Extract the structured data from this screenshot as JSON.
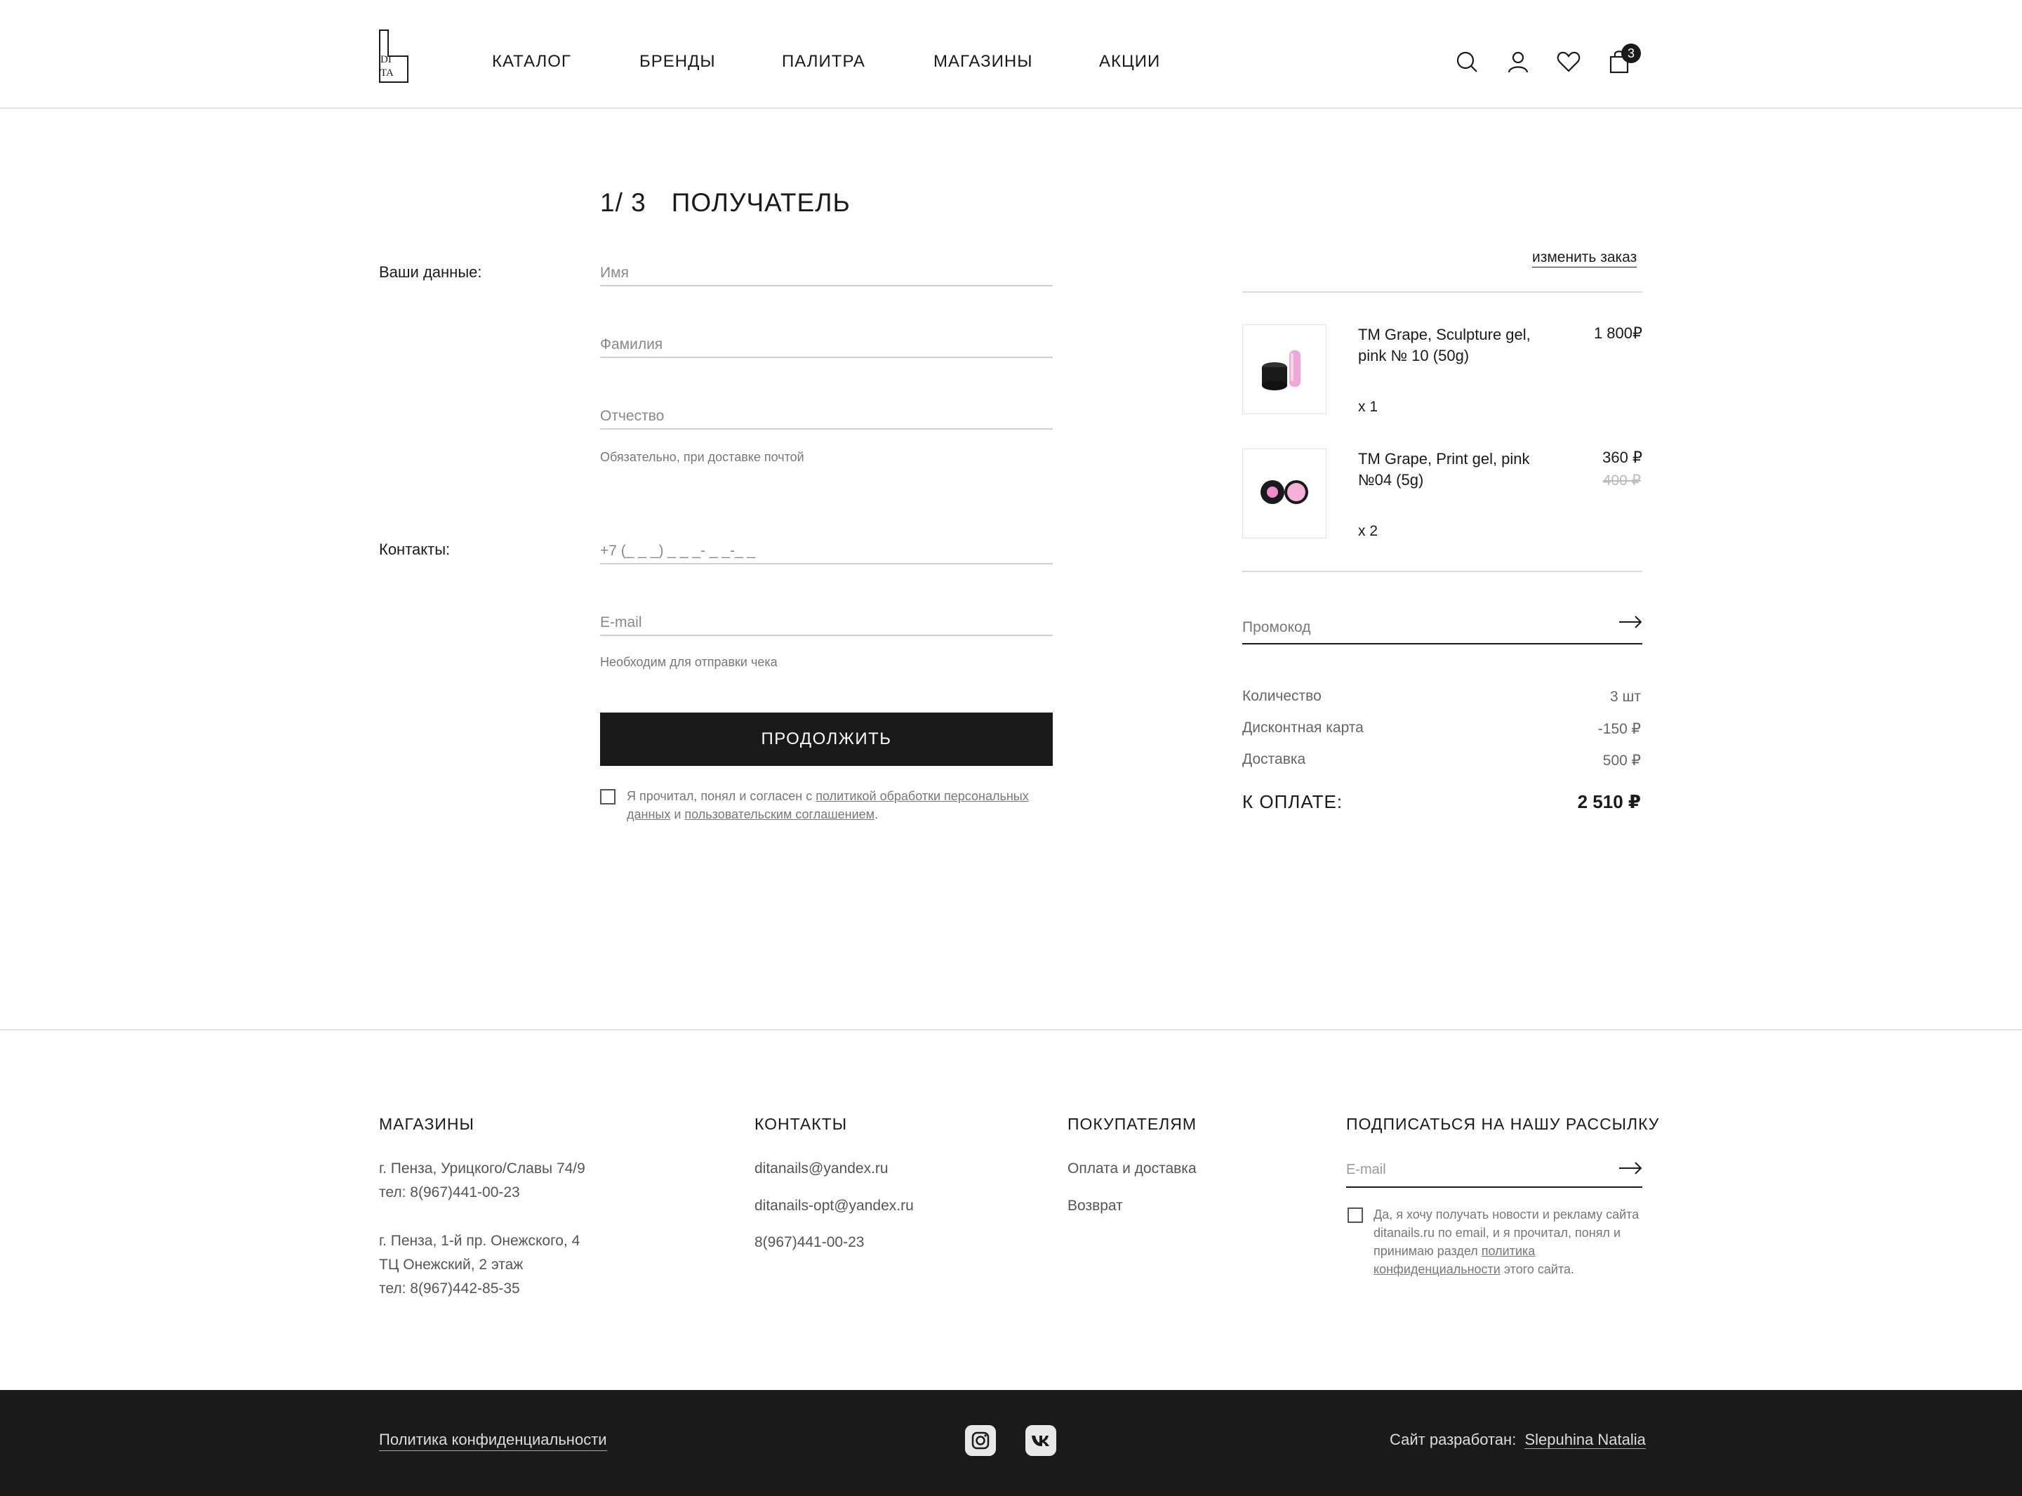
{
  "brand": {
    "logo_text": "DI TA"
  },
  "nav": {
    "items": [
      "КАТАЛОГ",
      "БРЕНДЫ",
      "ПАЛИТРА",
      "МАГАЗИНЫ",
      "АКЦИИ"
    ]
  },
  "cart": {
    "count": "3"
  },
  "checkout": {
    "step_number": "1/ 3",
    "step_title": "ПОЛУЧАТЕЛЬ",
    "your_data_label": "Ваши данные:",
    "first_name_placeholder": "Имя",
    "last_name_placeholder": "Фамилия",
    "patronymic_placeholder": "Отчество",
    "patronymic_hint": "Обязательно, при доставке почтой",
    "contacts_label": "Контакты:",
    "phone_placeholder": "+7 (_ _ _) _ _ _- _ _-_ _",
    "email_placeholder": "E-mail",
    "email_hint": "Необходим для отправки чека",
    "continue_label": "ПРОДОЛЖИТЬ",
    "consent_prefix": "Я прочитал, понял и согласен с ",
    "consent_link1": "политикой обработки персональных данных",
    "consent_mid": " и ",
    "consent_link2": "пользовательским соглашением",
    "consent_suffix": "."
  },
  "order": {
    "change_label": "изменить заказ",
    "items": [
      {
        "name": "TM Grape, Sculpture gel, pink № 10 (50g)",
        "price": "1 800₽",
        "qty": "x 1"
      },
      {
        "name": "TM Grape, Print gel, pink №04 (5g)",
        "price": "360 ₽",
        "old_price": "400 ₽",
        "qty": "x 2"
      }
    ],
    "promo_placeholder": "Промокод",
    "summary": [
      {
        "label": "Количество",
        "value": "3 шт"
      },
      {
        "label": "Дисконтная карта",
        "value": "-150 ₽"
      },
      {
        "label": "Доставка",
        "value": "500 ₽"
      }
    ],
    "total_label": "К ОПЛАТЕ:",
    "total_value": "2 510 ₽"
  },
  "footer": {
    "stores_title": "МАГАЗИНЫ",
    "stores": [
      [
        "г. Пенза, Урицкого/Славы 74/9",
        "тел: 8(967)441-00-23"
      ],
      [
        "г. Пенза, 1-й пр. Онежского, 4",
        "ТЦ Онежский, 2 этаж",
        "тел: 8(967)442-85-35"
      ]
    ],
    "contacts_title": "КОНТАКТЫ",
    "contacts": [
      "ditanails@yandex.ru",
      "ditanails-opt@yandex.ru",
      "8(967)441-00-23"
    ],
    "buyers_title": "ПОКУПАТЕЛЯМ",
    "buyers": [
      "Оплата и доставка",
      "Возврат"
    ],
    "subscribe_title": "ПОДПИСАТЬСЯ НА НАШУ РАССЫЛКУ",
    "subscribe_placeholder": "E-mail",
    "subscribe_consent_prefix": "Да, я хочу получать новости и рекламу сайта ditanails.ru по email, и я прочитал, понял и принимаю раздел ",
    "subscribe_consent_link": "политика конфиденциальности",
    "subscribe_consent_suffix": " этого сайта.",
    "privacy_link": "Политика конфиденциальности",
    "dev_label": "Сайт разработан:",
    "dev_name": "Slepuhina Natalia"
  },
  "colors": {
    "dark": "#1a1a1a",
    "muted": "#777777",
    "border": "#cfcfcf",
    "accent_pink": "#f0a8d8"
  }
}
